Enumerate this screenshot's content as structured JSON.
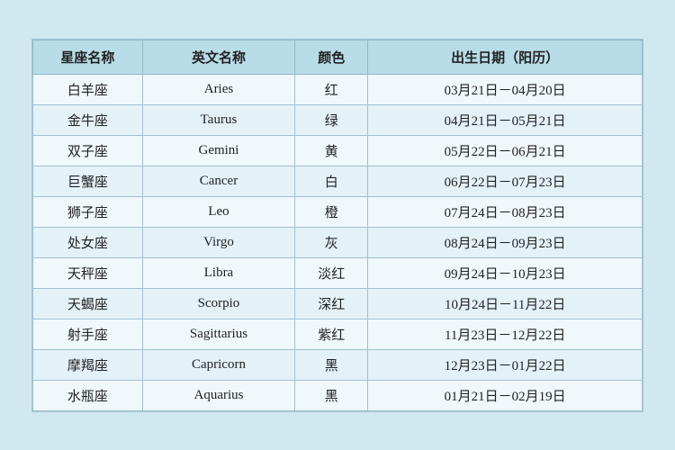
{
  "table": {
    "headers": [
      "星座名称",
      "英文名称",
      "颜色",
      "出生日期（阳历）"
    ],
    "rows": [
      {
        "chinese": "白羊座",
        "english": "Aries",
        "color": "红",
        "date": "03月21日－04月20日"
      },
      {
        "chinese": "金牛座",
        "english": "Taurus",
        "color": "绿",
        "date": "04月21日－05月21日"
      },
      {
        "chinese": "双子座",
        "english": "Gemini",
        "color": "黄",
        "date": "05月22日－06月21日"
      },
      {
        "chinese": "巨蟹座",
        "english": "Cancer",
        "color": "白",
        "date": "06月22日－07月23日"
      },
      {
        "chinese": "狮子座",
        "english": "Leo",
        "color": "橙",
        "date": "07月24日－08月23日"
      },
      {
        "chinese": "处女座",
        "english": "Virgo",
        "color": "灰",
        "date": "08月24日－09月23日"
      },
      {
        "chinese": "天秤座",
        "english": "Libra",
        "color": "淡红",
        "date": "09月24日－10月23日"
      },
      {
        "chinese": "天蝎座",
        "english": "Scorpio",
        "color": "深红",
        "date": "10月24日－11月22日"
      },
      {
        "chinese": "射手座",
        "english": "Sagittarius",
        "color": "紫红",
        "date": "11月23日－12月22日"
      },
      {
        "chinese": "摩羯座",
        "english": "Capricorn",
        "color": "黑",
        "date": "12月23日－01月22日"
      },
      {
        "chinese": "水瓶座",
        "english": "Aquarius",
        "color": "黑",
        "date": "01月21日－02月19日"
      }
    ]
  }
}
